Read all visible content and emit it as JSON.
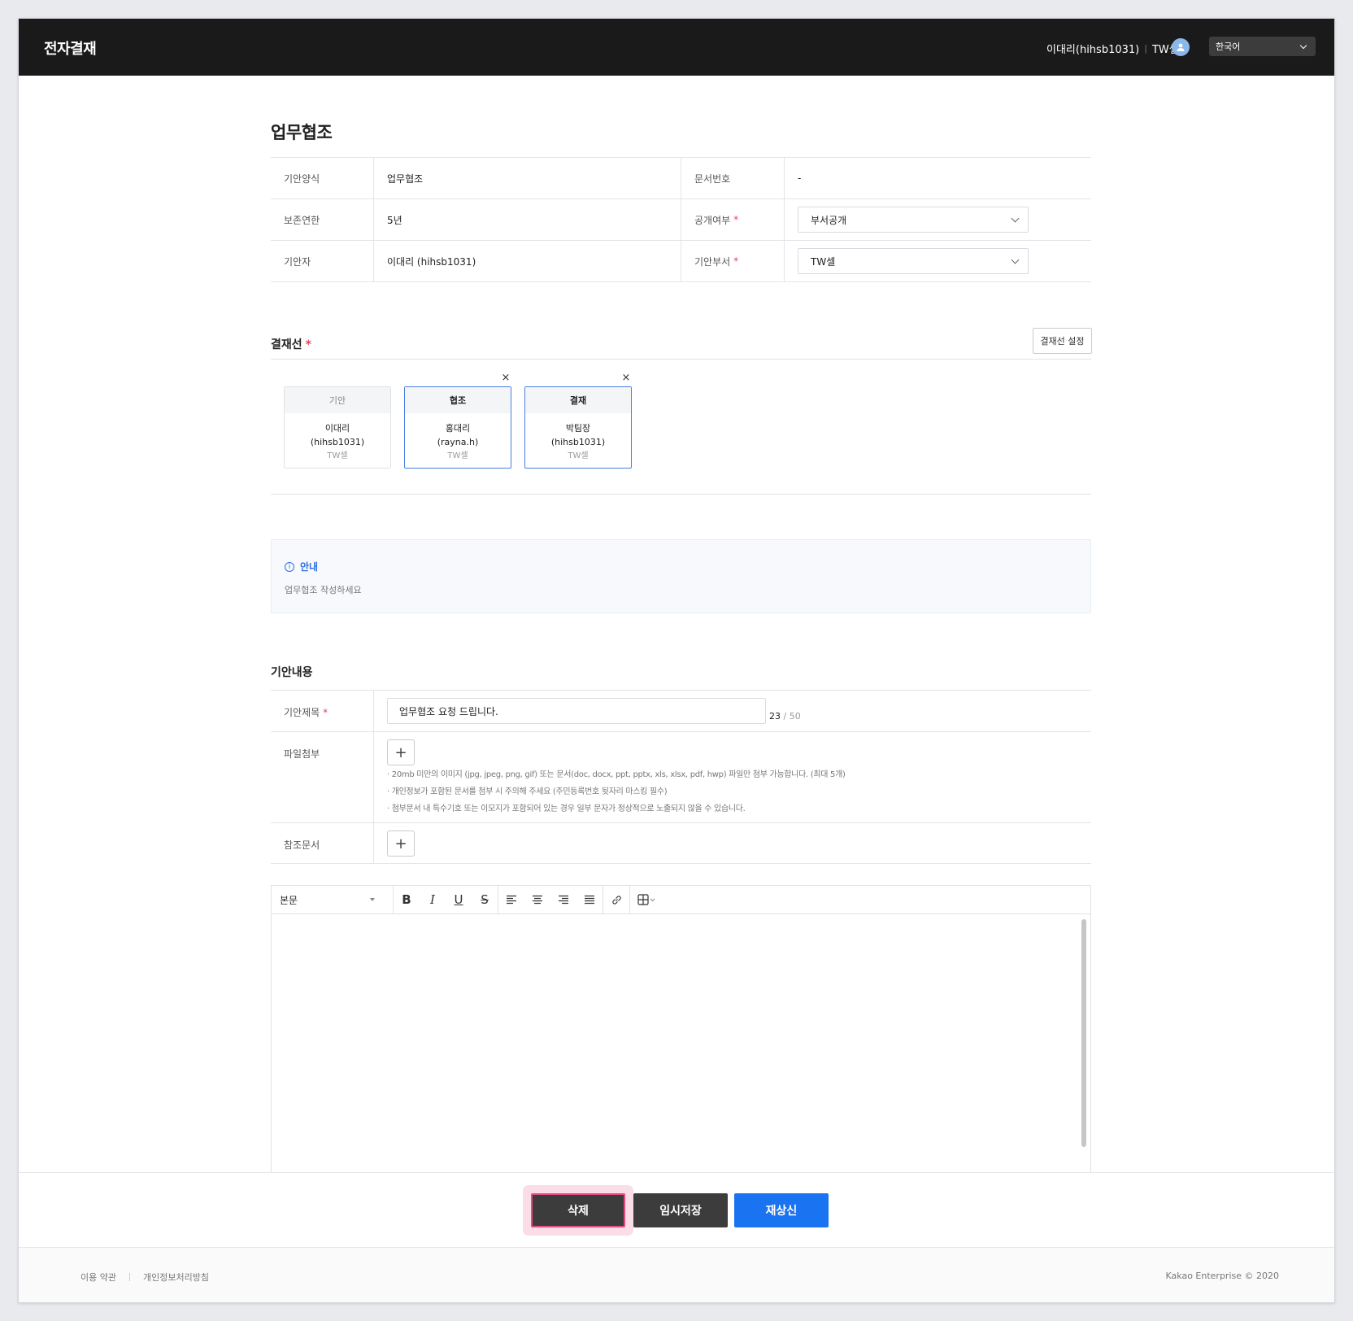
{
  "header": {
    "app_title": "전자결재",
    "user_name": "이대리(hihsb1031)",
    "user_dept": "TW셀",
    "language": "한국어"
  },
  "page": {
    "title": "업무협조"
  },
  "info_table": {
    "rows": [
      {
        "label1": "기안양식",
        "value1": "업무협조",
        "label2": "문서번호",
        "value2": "-"
      },
      {
        "label1": "보존연한",
        "value1": "5년",
        "label2": "공개여부",
        "value2": "부서공개"
      },
      {
        "label1": "기안자",
        "value1": "이대리 (hihsb1031)",
        "label2": "기안부서",
        "value2": "TW셀"
      }
    ],
    "required_mark": "*"
  },
  "approval_line": {
    "title": "결재선",
    "settings_button": "결재선 설정",
    "cards": [
      {
        "role": "기안",
        "name": "이대리",
        "id": "(hihsb1031)",
        "dept": "TW셀"
      },
      {
        "role": "협조",
        "name": "홍대리",
        "id": "(rayna.h)",
        "dept": "TW셀"
      },
      {
        "role": "결재",
        "name": "박팀장",
        "id": "(hihsb1031)",
        "dept": "TW셀"
      }
    ],
    "remove_symbol": "×"
  },
  "notice": {
    "title": "안내",
    "text": "업무협조 작성하세요"
  },
  "draft_content": {
    "section_title": "기안내용",
    "title_label": "기안제목",
    "title_value": "업무협조 요청 드립니다.",
    "char_count": "23",
    "char_max": "/ 50",
    "attachment_label": "파일첨부",
    "attachment_notes": [
      "· 20mb 미만의 이미지 (jpg, jpeg, png, gif) 또는 문서(doc, docx, ppt, pptx, xls, xlsx, pdf, hwp) 파일만 첨부 가능합니다. (최대 5개)",
      "· 개인정보가 포함된 문서를 첨부 시 주의해 주세요 (주민등록번호 뒷자리 마스킹 필수)",
      "· 첨부문서 내 특수기호 또는 이모지가 포함되어 있는 경우 일부 문자가 정상적으로 노출되지 않을 수 있습니다."
    ],
    "reference_label": "참조문서",
    "plus_symbol": "+"
  },
  "editor": {
    "paragraph_style": "본문",
    "tools": [
      "B",
      "I",
      "U",
      "S"
    ]
  },
  "actions": {
    "delete": "삭제",
    "temp_save": "임시저장",
    "resubmit": "재상신"
  },
  "footer": {
    "terms": "이용 약관",
    "privacy": "개인정보처리방침",
    "copyright": "Kakao Enterprise © 2020"
  },
  "colors": {
    "topbar": "#1a1a1a",
    "accent": "#1a73f0",
    "required": "#e8435a",
    "highlight": "#e44b7f"
  }
}
